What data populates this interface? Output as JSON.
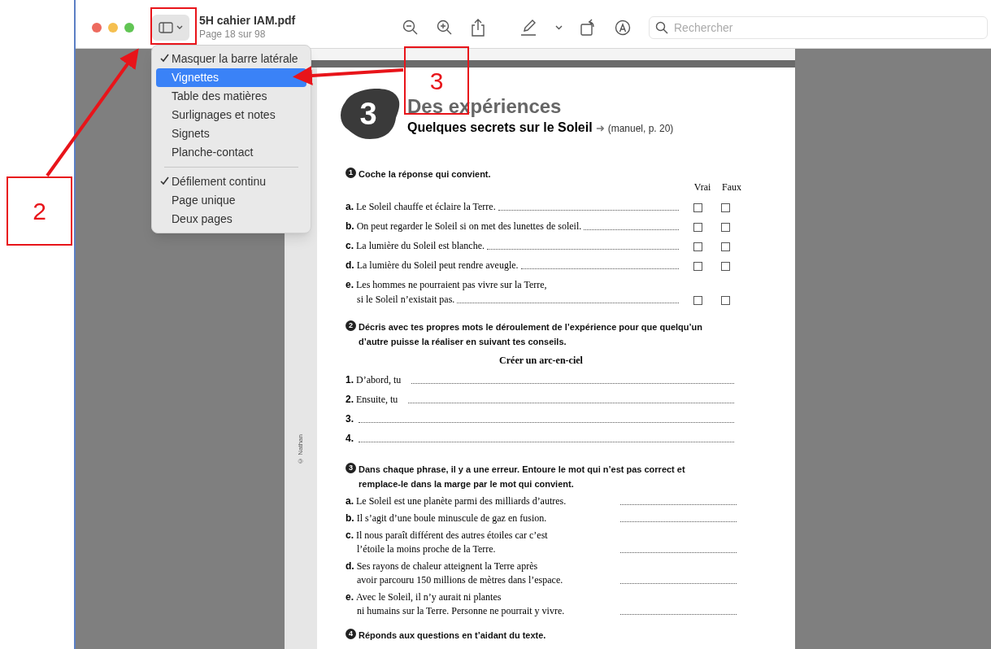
{
  "window": {
    "title": "5H cahier IAM.pdf",
    "subtitle": "Page 18 sur 98"
  },
  "search": {
    "placeholder": "Rechercher"
  },
  "sidebar_menu": {
    "sections": [
      [
        {
          "label": "Masquer la barre latérale",
          "checked": true,
          "selected": false
        },
        {
          "label": "Vignettes",
          "checked": false,
          "selected": true
        },
        {
          "label": "Table des matières",
          "checked": false,
          "selected": false
        },
        {
          "label": "Surlignages et notes",
          "checked": false,
          "selected": false
        },
        {
          "label": "Signets",
          "checked": false,
          "selected": false
        },
        {
          "label": "Planche-contact",
          "checked": false,
          "selected": false
        }
      ],
      [
        {
          "label": "Défilement continu",
          "checked": true,
          "selected": false
        },
        {
          "label": "Page unique",
          "checked": false,
          "selected": false
        },
        {
          "label": "Deux pages",
          "checked": false,
          "selected": false
        }
      ]
    ]
  },
  "document": {
    "margin_note": "© Nathan",
    "chapter": "3",
    "title": "Des expériences",
    "subtitle": "Quelques secrets sur le Soleil",
    "arrow": "➜",
    "reference": "(manuel, p. 20)",
    "exercise_1": {
      "number": "1",
      "instruction": "Coche la réponse qui convient.",
      "columns": [
        "Vrai",
        "Faux"
      ],
      "rows": [
        {
          "letter": "a.",
          "lines": [
            "Le Soleil chauffe et éclaire la Terre."
          ],
          "vrai_checked": false,
          "faux_checked": false
        },
        {
          "letter": "b.",
          "lines": [
            "On peut regarder le Soleil si on met des lunettes de soleil."
          ],
          "vrai_checked": false,
          "faux_checked": false
        },
        {
          "letter": "c.",
          "lines": [
            "La lumière du Soleil est blanche."
          ],
          "vrai_checked": false,
          "faux_checked": false
        },
        {
          "letter": "d.",
          "lines": [
            "La lumière du Soleil peut rendre aveugle."
          ],
          "vrai_checked": false,
          "faux_checked": false
        },
        {
          "letter": "e.",
          "lines": [
            "Les hommes ne pourraient pas vivre sur la Terre,",
            "si le Soleil n’existait pas."
          ],
          "vrai_checked": false,
          "faux_checked": false
        }
      ]
    },
    "exercise_2": {
      "number": "2",
      "instruction": "Décris avec tes propres mots le déroulement de l’expérience pour que quelqu’un d’autre puisse la réaliser en suivant tes conseils.",
      "heading": "Créer un arc-en-ciel",
      "steps": [
        {
          "number": "1.",
          "text": "D’abord, tu"
        },
        {
          "number": "2.",
          "text": "Ensuite, tu"
        },
        {
          "number": "3."
        },
        {
          "number": "4."
        }
      ]
    },
    "exercise_3": {
      "number": "3",
      "instruction": "Dans chaque phrase, il y a une erreur. Entoure le mot qui n’est pas correct et remplace-le dans la marge par le mot qui convient.",
      "rows": [
        {
          "letter": "a.",
          "lines": [
            "Le Soleil est une planète parmi des milliards d’autres."
          ]
        },
        {
          "letter": "b.",
          "lines": [
            "Il s’agit d’une boule minuscule de gaz en fusion."
          ]
        },
        {
          "letter": "c.",
          "lines": [
            "Il nous paraît différent des autres étoiles car c’est",
            "l’étoile la moins proche de la Terre."
          ]
        },
        {
          "letter": "d.",
          "lines": [
            "Ses rayons de chaleur atteignent la Terre après",
            "avoir parcouru 150 millions de mètres dans l’espace."
          ]
        },
        {
          "letter": "e.",
          "lines": [
            "Avec le Soleil, il n’y aurait ni plantes",
            "ni humains sur la Terre. Personne ne pourrait y vivre."
          ]
        }
      ]
    },
    "exercise_4": {
      "number": "4",
      "instruction": "Réponds aux questions en t’aidant du texte."
    }
  },
  "annotations": [
    {
      "label": "2"
    },
    {
      "label": "3"
    }
  ]
}
